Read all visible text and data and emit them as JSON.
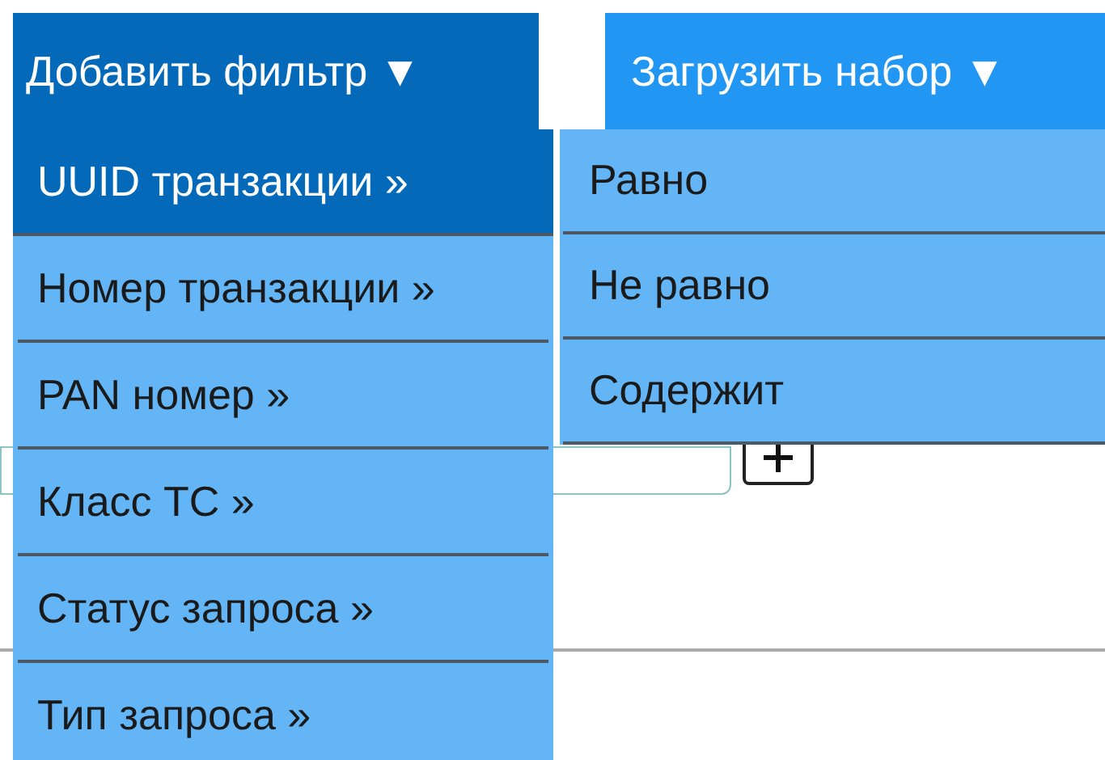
{
  "buttons": [
    {
      "label": "Добавить фильтр ▼",
      "open": true
    },
    {
      "label": "Загрузить набор ▼",
      "open": false
    }
  ],
  "filter_menu": [
    {
      "label": "UUID транзакции »",
      "selected": true
    },
    {
      "label": "Номер транзакции »",
      "selected": false
    },
    {
      "label": "PAN номер »",
      "selected": false
    },
    {
      "label": "Класс ТС »",
      "selected": false
    },
    {
      "label": "Статус запроса »",
      "selected": false
    },
    {
      "label": "Тип запроса »",
      "selected": false
    }
  ],
  "submenu": [
    {
      "label": "Равно"
    },
    {
      "label": "Не равно"
    },
    {
      "label": "Содержит"
    }
  ]
}
